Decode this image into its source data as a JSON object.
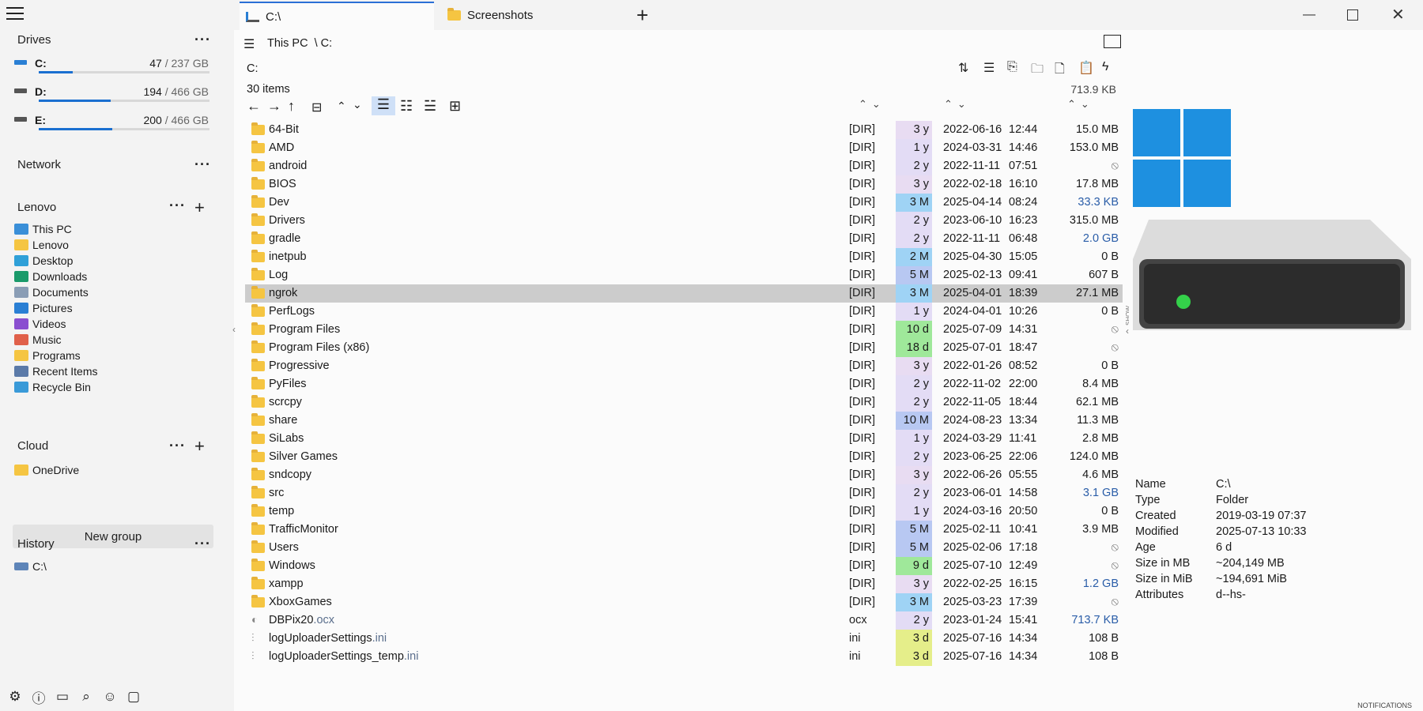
{
  "tabs": [
    {
      "label": "C:\\",
      "icon": "drive-icon"
    },
    {
      "label": "Screenshots",
      "icon": "folder-icon"
    }
  ],
  "sidebar": {
    "drives_title": "Drives",
    "drives": [
      {
        "label": "C:",
        "used": "47",
        "total": "/ 237 GB",
        "fill": 0.2
      },
      {
        "label": "D:",
        "used": "194",
        "total": "/ 466 GB",
        "fill": 0.42
      },
      {
        "label": "E:",
        "used": "200",
        "total": "/ 466 GB",
        "fill": 0.43
      }
    ],
    "network_title": "Network",
    "lenovo_title": "Lenovo",
    "lenovo_items": [
      {
        "label": "This PC",
        "color": "#3a8fd8"
      },
      {
        "label": "Lenovo",
        "color": "#f5c542"
      },
      {
        "label": "Desktop",
        "color": "#2fa0d8"
      },
      {
        "label": "Downloads",
        "color": "#1a9a6a"
      },
      {
        "label": "Documents",
        "color": "#8a9db5"
      },
      {
        "label": "Pictures",
        "color": "#2a7fd4"
      },
      {
        "label": "Videos",
        "color": "#8a4fd0"
      },
      {
        "label": "Music",
        "color": "#e0604a"
      },
      {
        "label": "Programs",
        "color": "#f5c542"
      },
      {
        "label": "Recent Items",
        "color": "#5b7aa8"
      },
      {
        "label": "Recycle Bin",
        "color": "#3a9ad8"
      }
    ],
    "cloud_title": "Cloud",
    "cloud_items": [
      {
        "label": "OneDrive",
        "color": "#f5c542"
      }
    ],
    "new_group": "New group",
    "history_title": "History",
    "history_items": [
      {
        "label": "C:\\"
      }
    ]
  },
  "main": {
    "breadcrumb_root": "This PC",
    "breadcrumb_sep": "\\ C:",
    "path": "C:",
    "item_count": "30 items",
    "total_size": "713.9 KB",
    "rows": [
      {
        "name": "64-Bit",
        "ext": "",
        "type": "[DIR]",
        "age": "3 y",
        "age_color": "#e8dcf2",
        "date": "2022-06-16",
        "time": "12:44",
        "size": "15.0 MB"
      },
      {
        "name": "AMD",
        "ext": "",
        "type": "[DIR]",
        "age": "1 y",
        "age_color": "#e3dcf5",
        "date": "2024-03-31",
        "time": "14:46",
        "size": "153.0 MB"
      },
      {
        "name": "android",
        "ext": "",
        "type": "[DIR]",
        "age": "2 y",
        "age_color": "#e3dcf5",
        "date": "2022-11-11",
        "time": "07:51",
        "size": "⦸"
      },
      {
        "name": "BIOS",
        "ext": "",
        "type": "[DIR]",
        "age": "3 y",
        "age_color": "#e8dcf2",
        "date": "2022-02-18",
        "time": "16:10",
        "size": "17.8 MB"
      },
      {
        "name": "Dev",
        "ext": "",
        "type": "[DIR]",
        "age": "3 M",
        "age_color": "#9fd3f5",
        "date": "2025-04-14",
        "time": "08:24",
        "size": "33.3 KB"
      },
      {
        "name": "Drivers",
        "ext": "",
        "type": "[DIR]",
        "age": "2 y",
        "age_color": "#e3dcf5",
        "date": "2023-06-10",
        "time": "16:23",
        "size": "315.0 MB"
      },
      {
        "name": "gradle",
        "ext": "",
        "type": "[DIR]",
        "age": "2 y",
        "age_color": "#e3dcf5",
        "date": "2022-11-11",
        "time": "06:48",
        "size": "2.0 GB"
      },
      {
        "name": "inetpub",
        "ext": "",
        "type": "[DIR]",
        "age": "2 M",
        "age_color": "#9fd3f5",
        "date": "2025-04-30",
        "time": "15:05",
        "size": "0 B"
      },
      {
        "name": "Log",
        "ext": "",
        "type": "[DIR]",
        "age": "5 M",
        "age_color": "#b8c8f2",
        "date": "2025-02-13",
        "time": "09:41",
        "size": "607 B"
      },
      {
        "name": "ngrok",
        "ext": "",
        "type": "[DIR]",
        "age": "3 M",
        "age_color": "#9fd3f5",
        "date": "2025-04-01",
        "time": "18:39",
        "size": "27.1 MB",
        "selected": true
      },
      {
        "name": "PerfLogs",
        "ext": "",
        "type": "[DIR]",
        "age": "1 y",
        "age_color": "#e3dcf5",
        "date": "2024-04-01",
        "time": "10:26",
        "size": "0 B"
      },
      {
        "name": "Program Files",
        "ext": "",
        "type": "[DIR]",
        "age": "10 d",
        "age_color": "#9fe89a",
        "date": "2025-07-09",
        "time": "14:31",
        "size": "⦸"
      },
      {
        "name": "Program Files (x86)",
        "ext": "",
        "type": "[DIR]",
        "age": "18 d",
        "age_color": "#9fe89a",
        "date": "2025-07-01",
        "time": "18:47",
        "size": "⦸"
      },
      {
        "name": "Progressive",
        "ext": "",
        "type": "[DIR]",
        "age": "3 y",
        "age_color": "#e8dcf2",
        "date": "2022-01-26",
        "time": "08:52",
        "size": "0 B"
      },
      {
        "name": "PyFiles",
        "ext": "",
        "type": "[DIR]",
        "age": "2 y",
        "age_color": "#e3dcf5",
        "date": "2022-11-02",
        "time": "22:00",
        "size": "8.4 MB"
      },
      {
        "name": "scrcpy",
        "ext": "",
        "type": "[DIR]",
        "age": "2 y",
        "age_color": "#e3dcf5",
        "date": "2022-11-05",
        "time": "18:44",
        "size": "62.1 MB"
      },
      {
        "name": "share",
        "ext": "",
        "type": "[DIR]",
        "age": "10 M",
        "age_color": "#b8c8f2",
        "date": "2024-08-23",
        "time": "13:34",
        "size": "11.3 MB"
      },
      {
        "name": "SiLabs",
        "ext": "",
        "type": "[DIR]",
        "age": "1 y",
        "age_color": "#e3dcf5",
        "date": "2024-03-29",
        "time": "11:41",
        "size": "2.8 MB"
      },
      {
        "name": "Silver Games",
        "ext": "",
        "type": "[DIR]",
        "age": "2 y",
        "age_color": "#e3dcf5",
        "date": "2023-06-25",
        "time": "22:06",
        "size": "124.0 MB"
      },
      {
        "name": "sndcopy",
        "ext": "",
        "type": "[DIR]",
        "age": "3 y",
        "age_color": "#e8dcf2",
        "date": "2022-06-26",
        "time": "05:55",
        "size": "4.6 MB"
      },
      {
        "name": "src",
        "ext": "",
        "type": "[DIR]",
        "age": "2 y",
        "age_color": "#e3dcf5",
        "date": "2023-06-01",
        "time": "14:58",
        "size": "3.1 GB"
      },
      {
        "name": "temp",
        "ext": "",
        "type": "[DIR]",
        "age": "1 y",
        "age_color": "#e3dcf5",
        "date": "2024-03-16",
        "time": "20:50",
        "size": "0 B"
      },
      {
        "name": "TrafficMonitor",
        "ext": "",
        "type": "[DIR]",
        "age": "5 M",
        "age_color": "#b8c8f2",
        "date": "2025-02-11",
        "time": "10:41",
        "size": "3.9 MB"
      },
      {
        "name": "Users",
        "ext": "",
        "type": "[DIR]",
        "age": "5 M",
        "age_color": "#b8c8f2",
        "date": "2025-02-06",
        "time": "17:18",
        "size": "⦸"
      },
      {
        "name": "Windows",
        "ext": "",
        "type": "[DIR]",
        "age": "9 d",
        "age_color": "#9fe89a",
        "date": "2025-07-10",
        "time": "12:49",
        "size": "⦸"
      },
      {
        "name": "xampp",
        "ext": "",
        "type": "[DIR]",
        "age": "3 y",
        "age_color": "#e8dcf2",
        "date": "2022-02-25",
        "time": "16:15",
        "size": "1.2 GB"
      },
      {
        "name": "XboxGames",
        "ext": "",
        "type": "[DIR]",
        "age": "3 M",
        "age_color": "#9fd3f5",
        "date": "2025-03-23",
        "time": "17:39",
        "size": "⦸"
      },
      {
        "name": "DBPix20",
        "ext": ".ocx",
        "type": "ocx",
        "age": "2 y",
        "age_color": "#e3dcf5",
        "date": "2023-01-24",
        "time": "15:41",
        "size": "713.7 KB",
        "file": "ocx"
      },
      {
        "name": "logUploaderSettings",
        "ext": ".ini",
        "type": "ini",
        "age": "3 d",
        "age_color": "#e5ee8a",
        "date": "2025-07-16",
        "time": "14:34",
        "size": "108 B",
        "file": "ini"
      },
      {
        "name": "logUploaderSettings_temp",
        "ext": ".ini",
        "type": "ini",
        "age": "3 d",
        "age_color": "#e5ee8a",
        "date": "2025-07-16",
        "time": "14:34",
        "size": "108 B",
        "file": "ini"
      }
    ]
  },
  "preview": {
    "side_label": "SHOW PREVIEW",
    "properties": [
      {
        "key": "Name",
        "value": "C:\\"
      },
      {
        "key": "Type",
        "value": "Folder"
      },
      {
        "key": "Created",
        "value": "2019-03-19  07:37"
      },
      {
        "key": "Modified",
        "value": "2025-07-13  10:33"
      },
      {
        "key": "Age",
        "value": "6 d"
      },
      {
        "key": "Size in MB",
        "value": "~204,149 MB"
      },
      {
        "key": "Size in MiB",
        "value": "~194,691 MiB"
      },
      {
        "key": "Attributes",
        "value": "d--hs-"
      }
    ]
  },
  "statusbar": {
    "notifications": "NOTIFICATIONS"
  },
  "colors": {
    "accent": "#1a6fd0",
    "selected_row": "#cccccc",
    "folder": "#f5c542"
  }
}
